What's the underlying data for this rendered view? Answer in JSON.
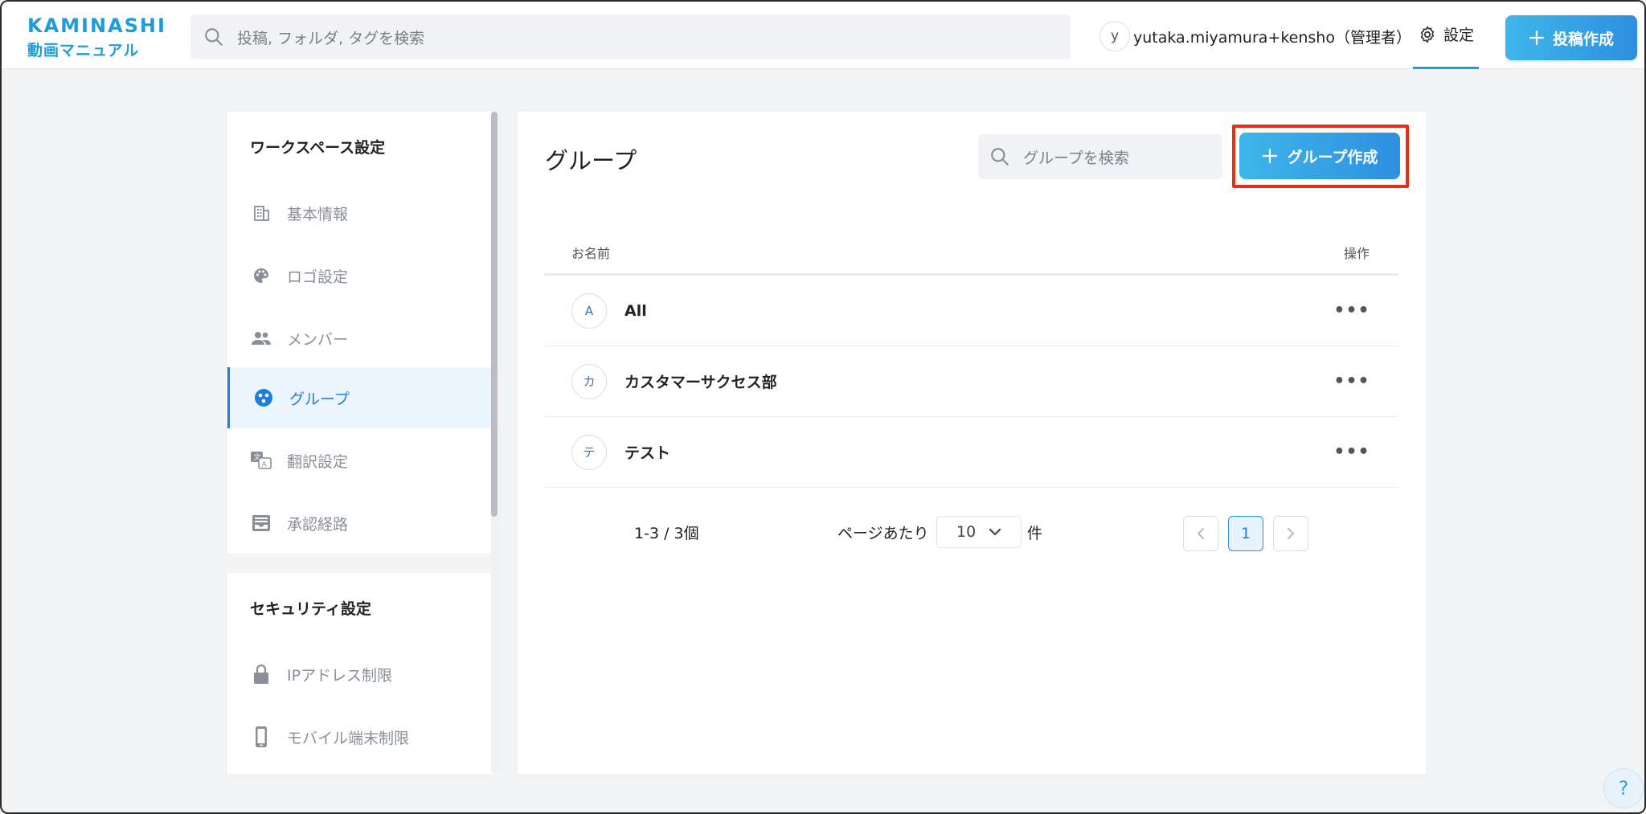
{
  "header": {
    "logo_top": "KAMINASHI",
    "logo_bottom": "動画マニュアル",
    "search_placeholder": "投稿, フォルダ, タグを検索",
    "user_initial": "y",
    "user_name": "yutaka.miyamura+kensho（管理者）",
    "settings_label": "設定",
    "post_button_label": "投稿作成"
  },
  "sidebar": {
    "workspace_title": "ワークスペース設定",
    "workspace_items": [
      {
        "label": "基本情報",
        "icon": "building-icon"
      },
      {
        "label": "ロゴ設定",
        "icon": "palette-icon"
      },
      {
        "label": "メンバー",
        "icon": "members-icon"
      },
      {
        "label": "グループ",
        "icon": "group-icon",
        "active": true
      },
      {
        "label": "翻訳設定",
        "icon": "translate-icon"
      },
      {
        "label": "承認経路",
        "icon": "inbox-icon"
      }
    ],
    "security_title": "セキュリティ設定",
    "security_items": [
      {
        "label": "IPアドレス制限",
        "icon": "lock-icon"
      },
      {
        "label": "モバイル端末制限",
        "icon": "mobile-icon"
      }
    ]
  },
  "main": {
    "title": "グループ",
    "search_placeholder": "グループを検索",
    "create_button_label": "グループ作成",
    "columns": {
      "name": "お名前",
      "actions": "操作"
    },
    "rows": [
      {
        "initial": "A",
        "name": "All"
      },
      {
        "initial": "カ",
        "name": "カスタマーサクセス部"
      },
      {
        "initial": "テ",
        "name": "テスト"
      }
    ],
    "pager": {
      "count_text": "1-3 / 3個",
      "per_page_label": "ページあたり",
      "per_page_value": "10",
      "per_page_unit": "件",
      "current_page": "1"
    }
  },
  "help_label": "?",
  "colors": {
    "accent": "#1e9bdc",
    "button_gradient_start": "#3fb6ea",
    "button_gradient_end": "#2d8fe0",
    "highlight": "#f02c10",
    "active_item_bg": "#ecf5fd"
  }
}
